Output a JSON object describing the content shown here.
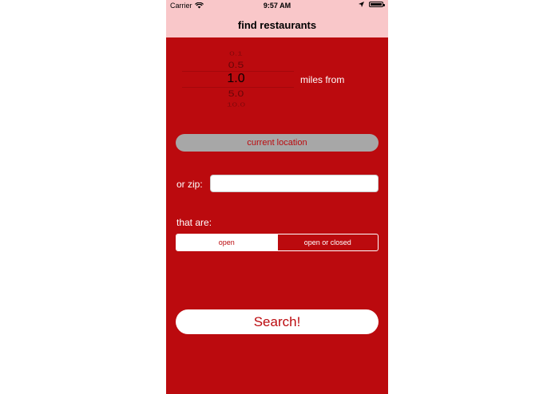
{
  "status_bar": {
    "carrier": "Carrier",
    "time": "9:57 AM",
    "icons": [
      "wifi-icon",
      "location-arrow-icon",
      "battery-icon"
    ]
  },
  "nav": {
    "title": "find restaurants"
  },
  "distance_picker": {
    "options": [
      "0.1",
      "0.5",
      "1.0",
      "5.0",
      "10.0"
    ],
    "selected": "1.0",
    "suffix_label": "miles from"
  },
  "location": {
    "current_location_label": "current location"
  },
  "zip": {
    "label": "or zip:",
    "value": "",
    "placeholder": ""
  },
  "filter": {
    "label": "that are:",
    "segments": [
      "open",
      "open or closed"
    ],
    "selected": "open"
  },
  "search": {
    "label": "Search!"
  },
  "colors": {
    "background": "#bb0a0e",
    "header": "#f9c7c9",
    "button_gray": "#a7a7a7",
    "white": "#ffffff"
  }
}
